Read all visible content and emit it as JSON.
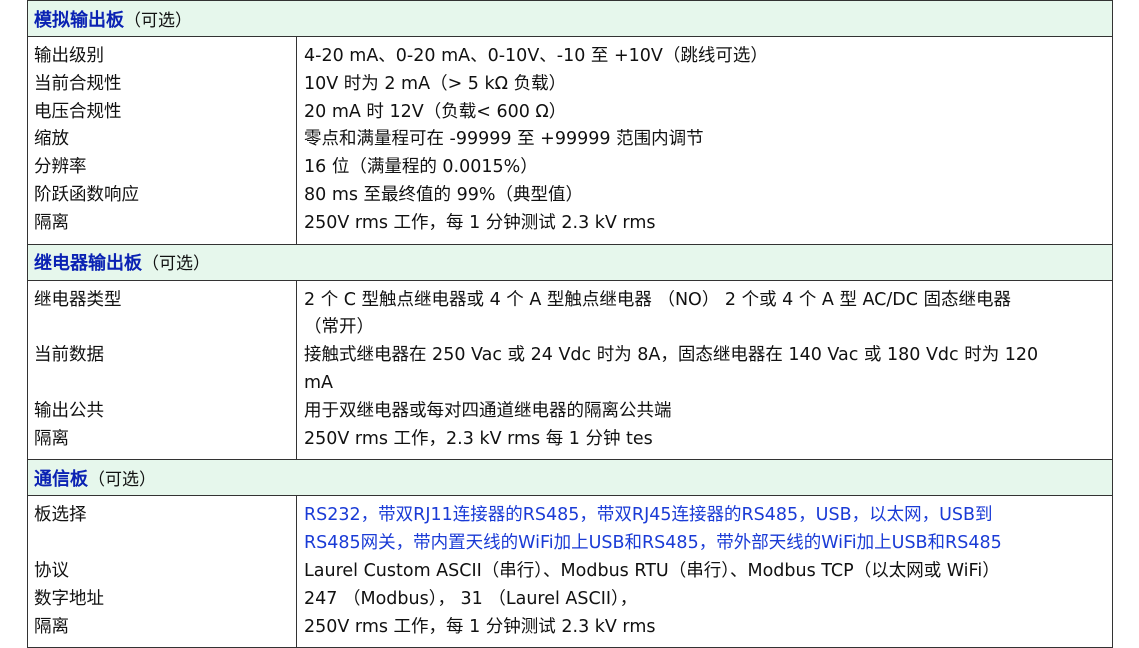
{
  "sections": [
    {
      "title": "模拟输出板",
      "note": "（可选）",
      "rows": [
        {
          "label": "输出级别",
          "value": [
            "4-20 mA、0-20 mA、0-10V、-10 至 +10V（跳线可选）"
          ]
        },
        {
          "label": "当前合规性",
          "value": [
            "10V 时为 2 mA（> 5 kΩ 负载）"
          ]
        },
        {
          "label": "电压合规性",
          "value": [
            "20 mA 时 12V（负载< 600 Ω）"
          ]
        },
        {
          "label": "缩放",
          "value": [
            "零点和满量程可在 -99999 至 +99999 范围内调节"
          ]
        },
        {
          "label": "分辨率",
          "value": [
            "16 位（满量程的 0.0015%）"
          ]
        },
        {
          "label": "阶跃函数响应",
          "value": [
            "80 ms 至最终值的 99%（典型值）"
          ]
        },
        {
          "label": "隔离",
          "value": [
            "250V rms 工作，每 1 分钟测试 2.3 kV rms"
          ]
        }
      ]
    },
    {
      "title": "继电器输出板",
      "note": "（可选）",
      "rows": [
        {
          "label": "继电器类型",
          "value": [
            "2 个 C 型触点继电器或 4 个 A 型触点继电器 （NO） 2 个或 4 个 A 型 AC/DC 固态继电器",
            "（常开）"
          ]
        },
        {
          "label": "当前数据",
          "value": [
            "接触式继电器在 250 Vac 或 24 Vdc 时为 8A，固态继电器在 140 Vac 或 180 Vdc 时为 120",
            "mA"
          ]
        },
        {
          "label": "输出公共",
          "value": [
            "用于双继电器或每对四通道继电器的隔离公共端"
          ]
        },
        {
          "label": "隔离",
          "value": [
            "250V rms 工作，2.3 kV rms 每 1 分钟 tes"
          ]
        }
      ]
    },
    {
      "title": "通信板",
      "note": "（可选）",
      "rows": [
        {
          "label": "板选择",
          "link": true,
          "value": [
            "RS232，带双RJ11连接器的RS485，带双RJ45连接器的RS485，USB，以太网，USB到",
            "RS485网关，带内置天线的WiFi加上USB和RS485，带外部天线的WiFi加上USB和RS485"
          ]
        },
        {
          "label": "协议",
          "value": [
            "Laurel Custom ASCII（串行）、Modbus RTU（串行）、Modbus TCP（以太网或 WiFi）"
          ]
        },
        {
          "label": "数字地址",
          "value": [
            "247 （Modbus）， 31 （Laurel ASCII），"
          ]
        },
        {
          "label": "隔离",
          "value": [
            "250V rms 工作，每 1 分钟测试 2.3 kV rms"
          ]
        }
      ]
    }
  ],
  "colors": {
    "section_bg": "#e6f7ec",
    "section_title": "#0a22b3",
    "link": "#1a3bd6",
    "border": "#333333"
  }
}
